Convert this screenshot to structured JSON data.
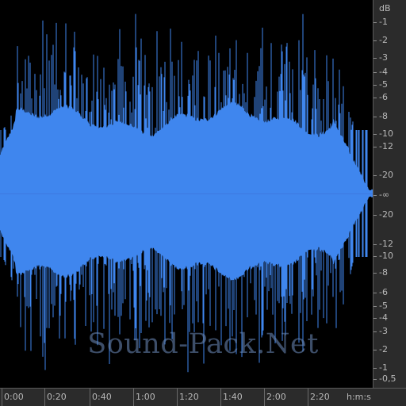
{
  "db_scale": {
    "unit": "dB",
    "labels": [
      "-1",
      "-2",
      "-3",
      "-4",
      "-5",
      "-6",
      "-8",
      "-10",
      "-12",
      "-20",
      "-∞",
      "-20",
      "-12",
      "-10",
      "-8",
      "-6",
      "-5",
      "-4",
      "-3",
      "-2",
      "-1",
      "-0,5"
    ]
  },
  "time_ruler": {
    "labels": [
      "0:00",
      "0:20",
      "0:40",
      "1:00",
      "1:20",
      "1:40",
      "2:00",
      "2:20"
    ],
    "unit": "h:m:s"
  },
  "watermark": "Sound-Pack.Net",
  "colors": {
    "background": "#000000",
    "waveform": "#3f86ee",
    "panel": "#2b2b2b",
    "text": "#b9b9b9"
  }
}
